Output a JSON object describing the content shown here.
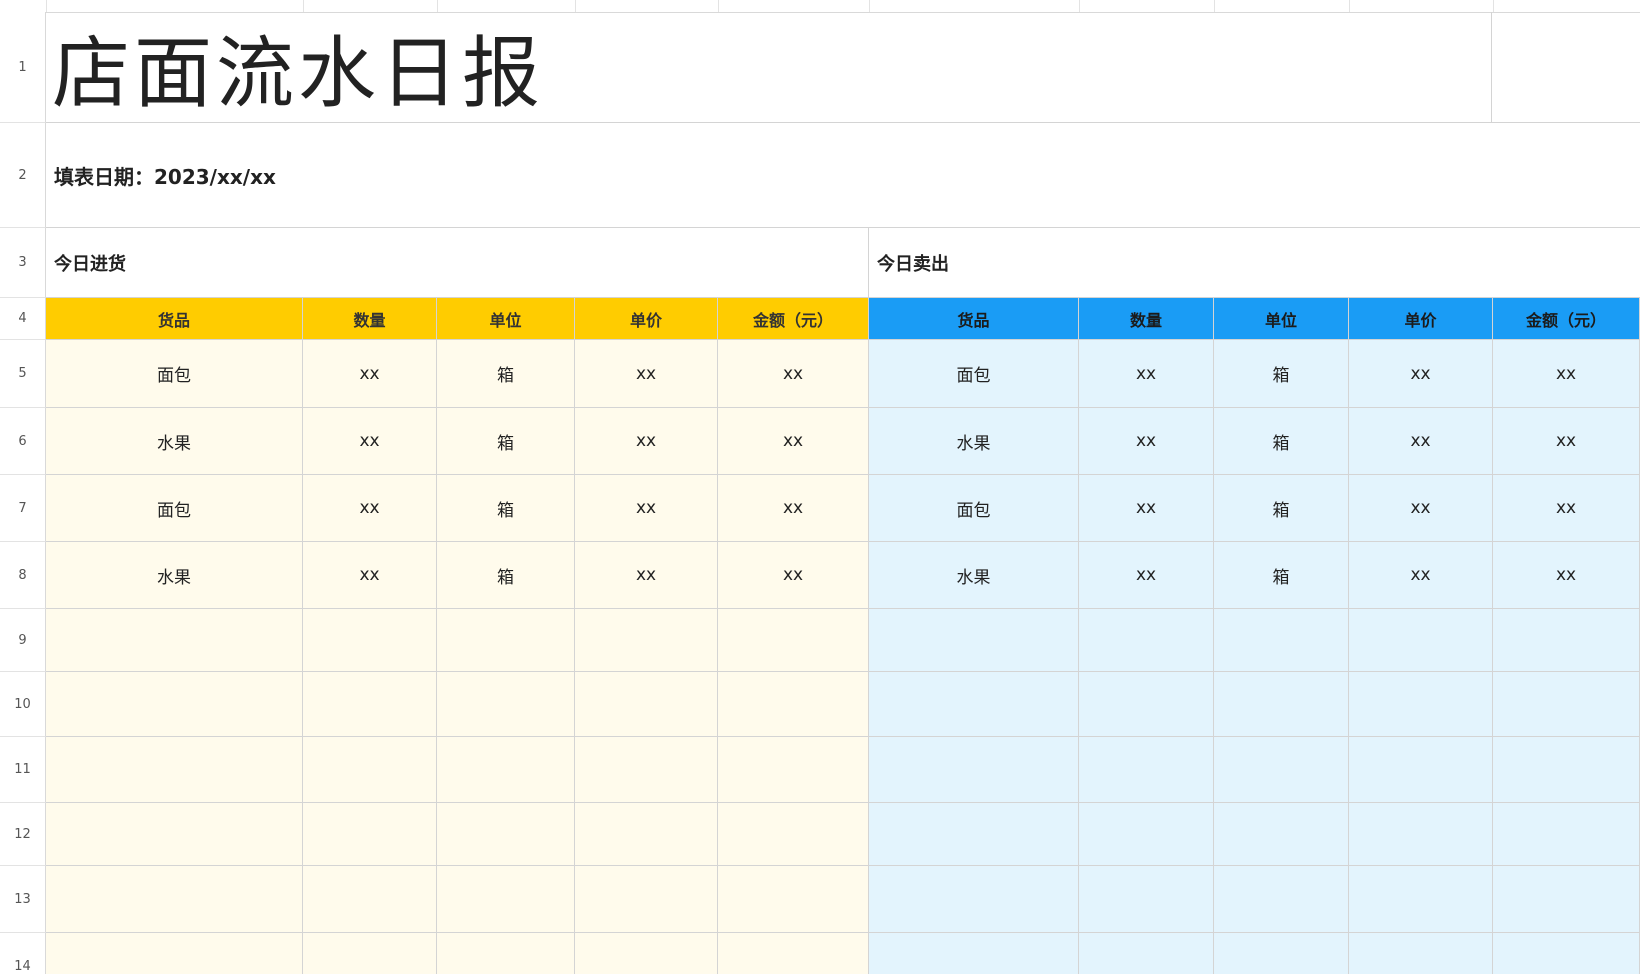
{
  "sheet": {
    "title": "店面流水日报",
    "date_label": "填表日期：2023/xx/xx",
    "section_left": "今日进货",
    "section_right": "今日卖出",
    "row_numbers": [
      "1",
      "2",
      "3",
      "4",
      "5",
      "6",
      "7",
      "8",
      "9",
      "10",
      "11",
      "12",
      "13",
      "14"
    ],
    "headers_left": [
      "货品",
      "数量",
      "单位",
      "单价",
      "金额（元）"
    ],
    "headers_right": [
      "货品",
      "数量",
      "单位",
      "单价",
      "金额（元）"
    ],
    "rows_left": [
      [
        "面包",
        "xx",
        "箱",
        "xx",
        "xx"
      ],
      [
        "水果",
        "xx",
        "箱",
        "xx",
        "xx"
      ],
      [
        "面包",
        "xx",
        "箱",
        "xx",
        "xx"
      ],
      [
        "水果",
        "xx",
        "箱",
        "xx",
        "xx"
      ],
      [
        "",
        "",
        "",
        "",
        ""
      ],
      [
        "",
        "",
        "",
        "",
        ""
      ],
      [
        "",
        "",
        "",
        "",
        ""
      ],
      [
        "",
        "",
        "",
        "",
        ""
      ],
      [
        "",
        "",
        "",
        "",
        ""
      ],
      [
        "",
        "",
        "",
        "",
        ""
      ]
    ],
    "rows_right": [
      [
        "面包",
        "xx",
        "箱",
        "xx",
        "xx"
      ],
      [
        "水果",
        "xx",
        "箱",
        "xx",
        "xx"
      ],
      [
        "面包",
        "xx",
        "箱",
        "xx",
        "xx"
      ],
      [
        "水果",
        "xx",
        "箱",
        "xx",
        "xx"
      ],
      [
        "",
        "",
        "",
        "",
        ""
      ],
      [
        "",
        "",
        "",
        "",
        ""
      ],
      [
        "",
        "",
        "",
        "",
        ""
      ],
      [
        "",
        "",
        "",
        "",
        ""
      ],
      [
        "",
        "",
        "",
        "",
        ""
      ],
      [
        "",
        "",
        "",
        "",
        ""
      ]
    ],
    "colors": {
      "header_left": "#ffcc00",
      "header_right": "#1a9cf5",
      "body_left": "#fffbec",
      "body_right": "#e3f4fd"
    }
  }
}
